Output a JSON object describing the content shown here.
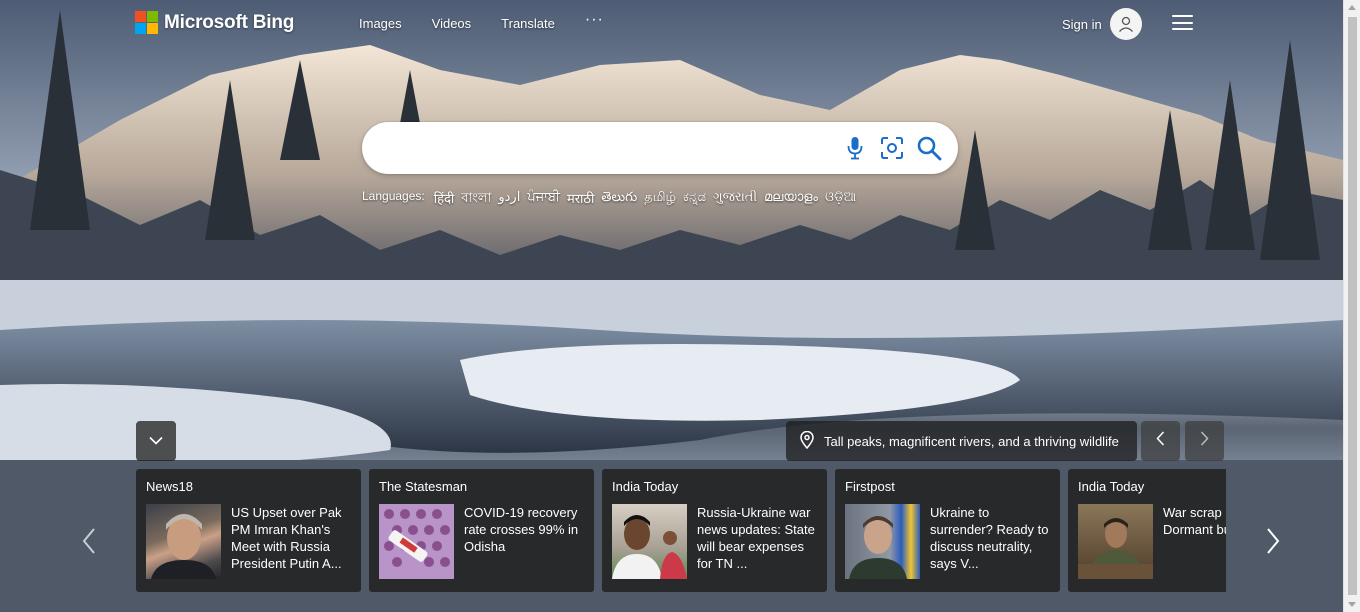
{
  "header": {
    "brand": "Microsoft Bing",
    "nav": [
      {
        "label": "Images"
      },
      {
        "label": "Videos"
      },
      {
        "label": "Translate"
      }
    ],
    "more_label": "···",
    "signin_label": "Sign in",
    "logo_colors": [
      "#f25022",
      "#7fba00",
      "#00a4ef",
      "#ffb900"
    ]
  },
  "search": {
    "value": "",
    "placeholder": "",
    "icons": [
      "microphone-icon",
      "visual-search-icon",
      "search-icon"
    ],
    "accent": "#1a6ec7"
  },
  "languages": {
    "label": "Languages:",
    "items": [
      "हिंदी",
      "বাংলা",
      "اردو",
      "ਪੰਜਾਬੀ",
      "मराठी",
      "తెలుగు",
      "தமிழ்",
      "ಕನ್ನಡ",
      "ગુજરાતી",
      "മലയാളം",
      "ଓଡ଼ିଆ"
    ]
  },
  "image_caption": "Tall peaks, magnificent rivers, and a thriving wildlife",
  "news": [
    {
      "source": "News18",
      "title": "US Upset over Pak PM Imran Khan's Meet with Russia President Putin A..."
    },
    {
      "source": "The Statesman",
      "title": "COVID-19 recovery rate crosses 99% in Odisha"
    },
    {
      "source": "India Today",
      "title": "Russia-Ukraine war news updates: State will bear expenses for TN ..."
    },
    {
      "source": "Firstpost",
      "title": "Ukraine to surrender? Ready to discuss neutrality, says V..."
    },
    {
      "source": "India Today",
      "title": "War scrap r Dormant bu"
    }
  ]
}
